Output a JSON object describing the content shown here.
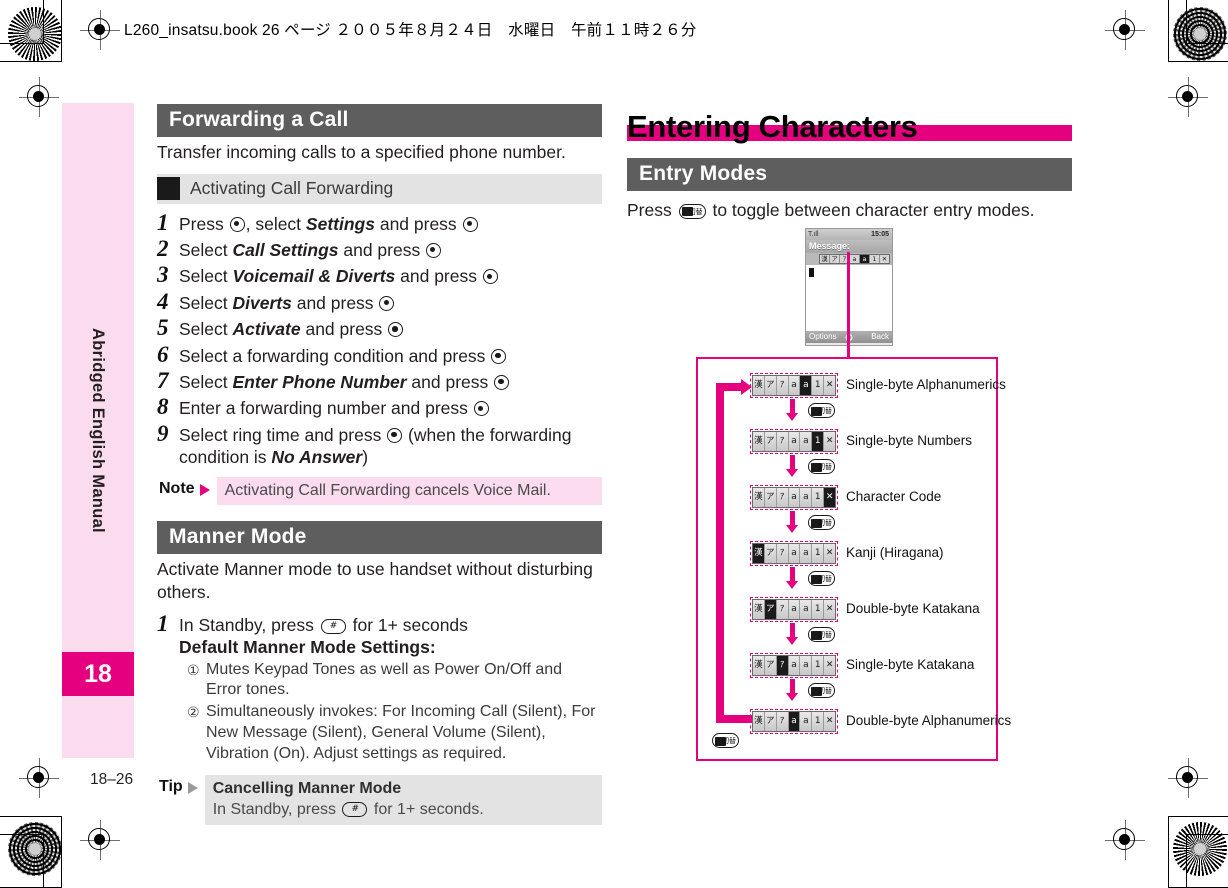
{
  "page": {
    "header_line": "L260_insatsu.book  26 ページ  ２００５年８月２４日　水曜日　午前１１時２６分",
    "page_number": "18–26",
    "sidebar_label": "Abridged English Manual",
    "chapter_number": "18"
  },
  "left_column": {
    "section_title": "Forwarding a Call",
    "intro": "Transfer incoming calls to a specified phone number.",
    "subsection_title": "Activating Call Forwarding",
    "steps": [
      {
        "n": "1",
        "pre": "Press ",
        "icon": "center-key",
        "mid": ", select ",
        "em": "Settings",
        "post": " and press ",
        "icon2": "center-key"
      },
      {
        "n": "2",
        "pre": "Select ",
        "em": "Call Settings",
        "post": " and press ",
        "icon2": "center-key"
      },
      {
        "n": "3",
        "pre": "Select ",
        "em": "Voicemail & Diverts",
        "post": " and press ",
        "icon2": "center-key"
      },
      {
        "n": "4",
        "pre": "Select ",
        "em": "Diverts",
        "post": " and press ",
        "icon2": "center-key"
      },
      {
        "n": "5",
        "pre": "Select ",
        "em": "Activate",
        "post": " and press ",
        "icon2": "center-key"
      },
      {
        "n": "6",
        "pre": "Select a forwarding condition and press ",
        "em": "",
        "post": "",
        "icon2": "center-key"
      },
      {
        "n": "7",
        "pre": "Select ",
        "em": "Enter Phone Number",
        "post": " and press ",
        "icon2": "center-key"
      },
      {
        "n": "8",
        "pre": "Enter a forwarding number and press ",
        "em": "",
        "post": "",
        "icon2": "center-key"
      },
      {
        "n": "9",
        "pre": "Select ring time and press ",
        "em": "",
        "post": "",
        "icon2": "center-key",
        "tail_pre": " (when the forwarding condition is ",
        "tail_em": "No Answer",
        "tail_post": ")"
      }
    ],
    "note": {
      "label": "Note",
      "text": "Activating Call Forwarding cancels Voice Mail."
    },
    "manner": {
      "section_title": "Manner Mode",
      "intro": "Activate Manner mode to use handset without disturbing others.",
      "step_number": "1",
      "step_line1_pre": "In Standby, press ",
      "step_line1_post": " for 1+ seconds",
      "step_line2": "Default Manner Mode Settings:",
      "bullets": [
        {
          "mark": "①",
          "text": "Mutes Keypad Tones as well as Power On/Off and Error tones."
        },
        {
          "mark": "②",
          "text": "Simultaneously invokes: For Incoming Call (Silent), For New Message (Silent), General Volume (Silent), Vibration (On). Adjust settings as required."
        }
      ],
      "tip": {
        "label": "Tip",
        "title": "Cancelling Manner Mode",
        "line_pre": "In Standby, press ",
        "line_post": " for 1+ seconds."
      }
    }
  },
  "right_column": {
    "big_title": "Entering Characters",
    "section_title": "Entry Modes",
    "intro_pre": "Press ",
    "intro_post": " to toggle between character entry modes.",
    "phone": {
      "signal": "T.ıll",
      "clock": "15:05",
      "title": "Message:",
      "softkey_left": "Options",
      "softkey_right": "Back",
      "mode_cells": [
        "漢",
        "ア",
        "ｱ",
        "a",
        "a",
        "1",
        "✕"
      ],
      "active_index": 4
    },
    "flow": {
      "cells": [
        "漢",
        "ア",
        "ｱ",
        "a",
        "a",
        "1",
        "✕"
      ],
      "key_label": "mode-key",
      "items": [
        {
          "label": "Single-byte Alphanumerics",
          "active": 4
        },
        {
          "label": "Single-byte Numbers",
          "active": 5
        },
        {
          "label": "Character Code",
          "active": 6
        },
        {
          "label": "Kanji (Hiragana)",
          "active": 0
        },
        {
          "label": "Double-byte Katakana",
          "active": 1
        },
        {
          "label": "Single-byte Katakana",
          "active": 2
        },
        {
          "label": "Double-byte Alphanumerics",
          "active": 3
        }
      ]
    }
  },
  "colors": {
    "magenta": "#e4007f",
    "pale_pink": "#fbdcee",
    "heading_gray": "#5e5e5e",
    "sub_gray": "#e3e3e3"
  }
}
